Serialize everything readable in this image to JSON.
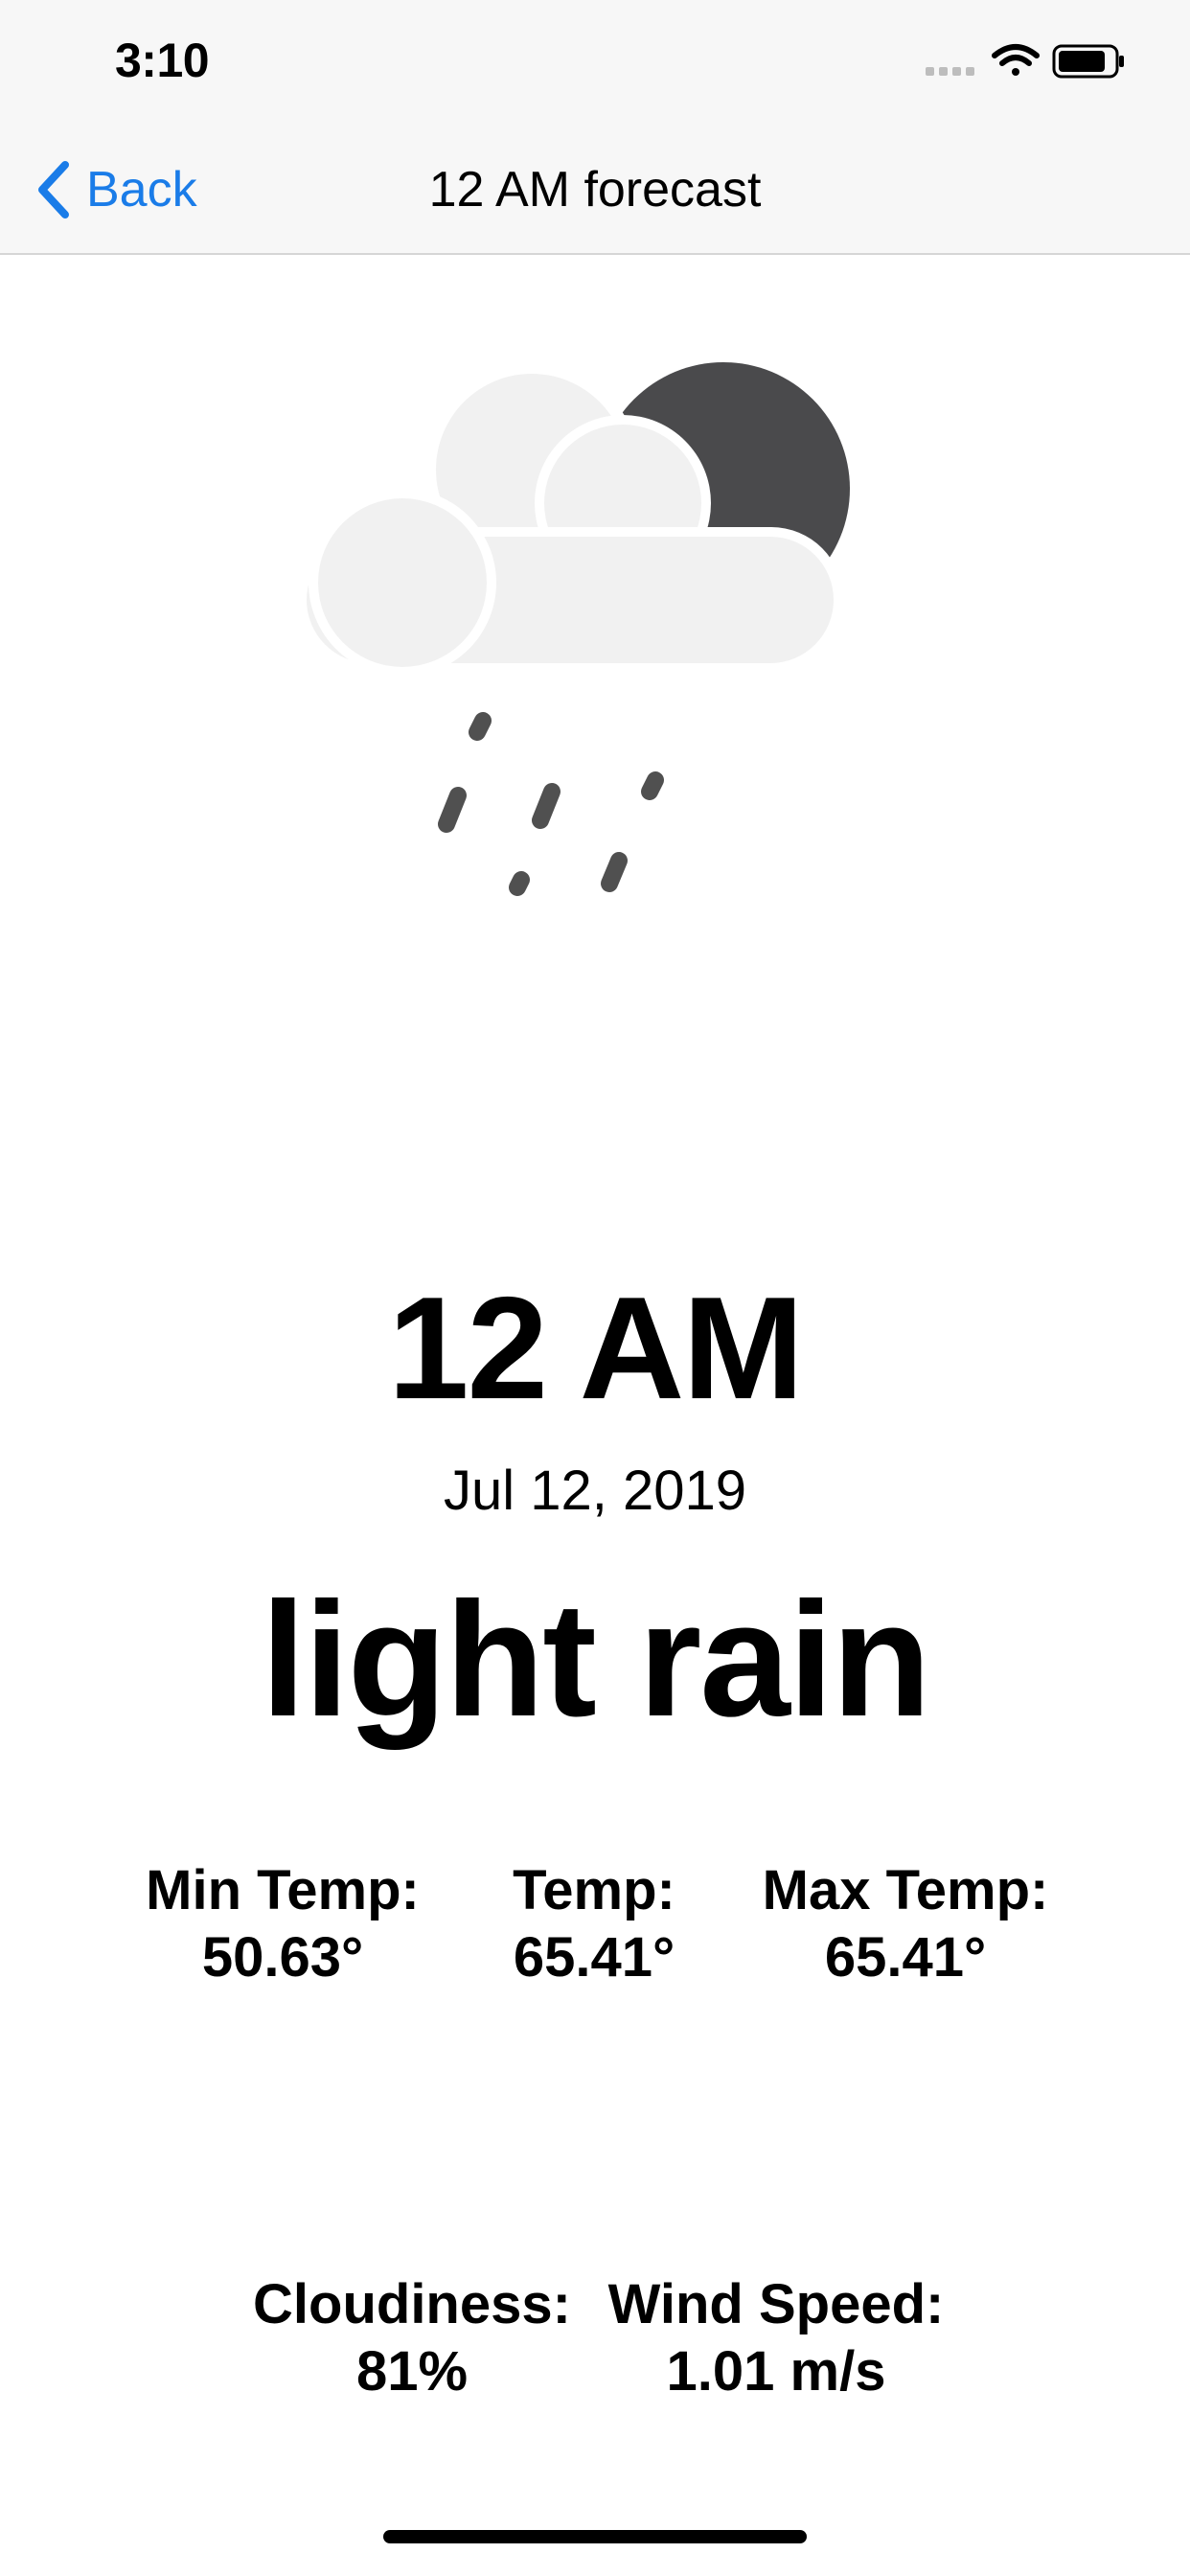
{
  "status_bar": {
    "time": "3:10",
    "icons": [
      "signal-dots-icon",
      "wifi-icon",
      "battery-icon"
    ]
  },
  "nav": {
    "back_label": "Back",
    "title": "12 AM forecast",
    "accent_color": "#1a7ce8"
  },
  "forecast": {
    "icon": "cloud-moon-rain-icon",
    "hour": "12 AM",
    "date": "Jul 12, 2019",
    "description": "light rain",
    "min_temp": {
      "label": "Min Temp:",
      "value": "50.63°"
    },
    "temp": {
      "label": "Temp:",
      "value": "65.41°"
    },
    "max_temp": {
      "label": "Max Temp:",
      "value": "65.41°"
    },
    "cloudiness": {
      "label": "Cloudiness:",
      "value": "81%"
    },
    "wind_speed": {
      "label": "Wind Speed:",
      "value": "1.01 m/s"
    }
  }
}
